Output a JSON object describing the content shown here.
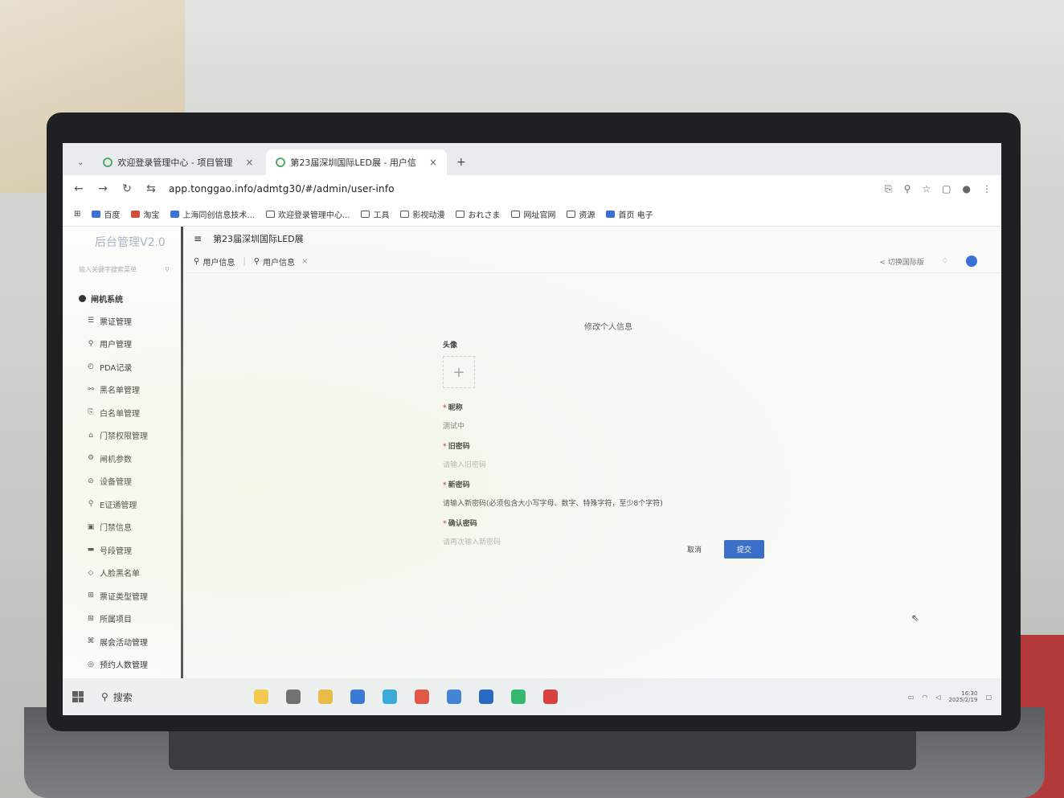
{
  "browser": {
    "tabs": [
      {
        "label": "欢迎登录管理中心 - 项目管理"
      },
      {
        "label": "第23届深圳国际LED展 - 用户信"
      }
    ],
    "new_tab": "+",
    "url": "app.tonggao.info/admtg30/#/admin/user-info",
    "bookmarks": [
      {
        "label": "百度"
      },
      {
        "label": "淘宝"
      },
      {
        "label": "上海同创信息技术..."
      },
      {
        "label": "欢迎登录管理中心..."
      },
      {
        "label": "工具"
      },
      {
        "label": "影视动漫"
      },
      {
        "label": "おれさま"
      },
      {
        "label": "网址官网"
      },
      {
        "label": "资源"
      },
      {
        "label": "首页 电子"
      }
    ]
  },
  "sidebar": {
    "logo": "后台管理V2.0",
    "search_placeholder": "输入关键字搜索菜单",
    "group": "闸机系统",
    "items": [
      {
        "icon": "☰",
        "label": "票证管理"
      },
      {
        "icon": "⚲",
        "label": "用户管理"
      },
      {
        "icon": "◴",
        "label": "PDA记录"
      },
      {
        "icon": "⚯",
        "label": "黑名单管理"
      },
      {
        "icon": "⎘",
        "label": "白名单管理"
      },
      {
        "icon": "⌂",
        "label": "门禁权限管理"
      },
      {
        "icon": "⚙",
        "label": "闸机参数"
      },
      {
        "icon": "⊘",
        "label": "设备管理"
      },
      {
        "icon": "⚲",
        "label": "E证通管理"
      },
      {
        "icon": "▣",
        "label": "门禁信息"
      },
      {
        "icon": "▬",
        "label": "号段管理"
      },
      {
        "icon": "◇",
        "label": "人脸黑名单"
      },
      {
        "icon": "⊞",
        "label": "票证类型管理"
      },
      {
        "icon": "⊞",
        "label": "所属项目"
      },
      {
        "icon": "⌘",
        "label": "展会活动管理"
      },
      {
        "icon": "◎",
        "label": "预约人数管理"
      }
    ]
  },
  "main": {
    "title": "第23届深圳国际LED展",
    "tags": [
      {
        "label": "用户信息"
      },
      {
        "label": "用户信息"
      }
    ],
    "head_right_text": "< 切换国际版"
  },
  "form": {
    "title": "修改个人信息",
    "avatar_label": "头像",
    "nickname_label": "昵称",
    "nickname_value": "测试中",
    "old_password_label": "旧密码",
    "old_password_placeholder": "请输入旧密码",
    "new_password_label": "新密码",
    "new_password_placeholder": "请输入新密码(必须包含大小写字母、数字、特殊字符，至少8个字符)",
    "confirm_password_label": "确认密码",
    "confirm_password_placeholder": "请再次输入新密码",
    "cancel_label": "取消",
    "submit_label": "提交"
  },
  "taskbar": {
    "search_label": "搜索",
    "time": "16:30",
    "date": "2025/2/19"
  }
}
